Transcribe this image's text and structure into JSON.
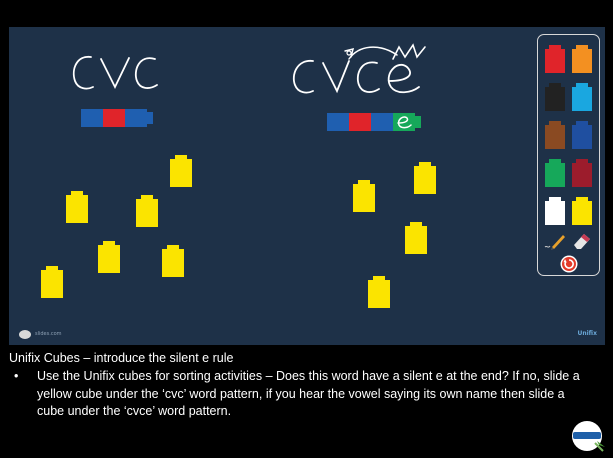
{
  "stage": {
    "left_word": "CVC",
    "right_word": "CVCe",
    "logo_text": "slides.com",
    "brand": "Unifix"
  },
  "caption": {
    "title": "Unifix Cubes – introduce the silent e rule",
    "bullet": "Use the Unifix cubes for sorting activities – Does this word have a silent e at the end?  If no, slide a yellow cube under the ‘cvc’ word pattern, if you hear the vowel saying its own name then slide a cube under the ‘cvce’ word pattern."
  },
  "colors": {
    "background": "#1e3148",
    "cube_yellow": "#fbe400",
    "cube_blue": "#1f5fb0",
    "cube_red": "#e0242a",
    "cube_green": "#16a85a"
  },
  "palette": {
    "swatches": [
      "#e0242a",
      "#f39021",
      "#222222",
      "#1aa7e0",
      "#8a4a22",
      "#1f4fa0",
      "#16a85a",
      "#9c1c2c",
      "#ffffff",
      "#fbe400"
    ],
    "tools": [
      "pencil-icon",
      "eraser-icon",
      "reset-icon"
    ]
  }
}
